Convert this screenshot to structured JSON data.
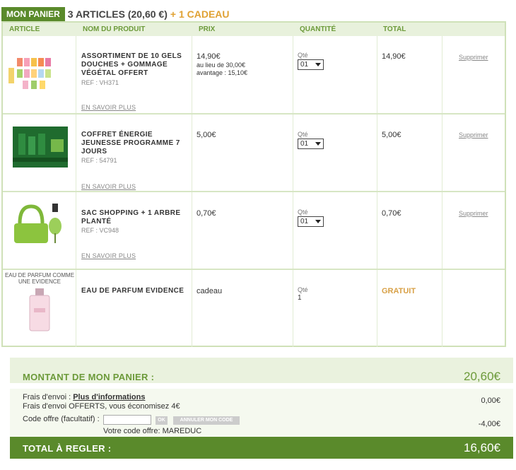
{
  "header": {
    "tab": "MON PANIER",
    "count": "3 ARTICLES (20,60 €)",
    "gift": "+ 1 CADEAU"
  },
  "columns": {
    "article": "ARTICLE",
    "name": "NOM DU PRODUIT",
    "price": "PRIX",
    "qty": "QUANTITÉ",
    "total": "TOTAL"
  },
  "items": [
    {
      "name": "ASSORTIMENT DE 10 GELS DOUCHES + GOMMAGE VÉGÉTAL OFFERT",
      "ref": "REF : VH371",
      "more": "EN SAVOIR PLUS",
      "price": "14,90€",
      "old": "au lieu de 30,00€",
      "saving": "avantage : 15,10€",
      "qty_label": "Qté",
      "qty": "01",
      "total": "14,90€",
      "delete": "Supprimer"
    },
    {
      "name": "COFFRET ÉNERGIE JEUNESSE PROGRAMME 7 JOURS",
      "ref": "REF : 54791",
      "more": "EN SAVOIR PLUS",
      "price": "5,00€",
      "qty_label": "Qté",
      "qty": "01",
      "total": "5,00€",
      "delete": "Supprimer"
    },
    {
      "name": "SAC SHOPPING + 1 ARBRE PLANTÉ",
      "ref": "REF : VC948",
      "more": "EN SAVOIR PLUS",
      "price": "0,70€",
      "qty_label": "Qté",
      "qty": "01",
      "total": "0,70€",
      "delete": "Supprimer"
    },
    {
      "name": "EAU DE PARFUM EVIDENCE",
      "image_caption": "EAU DE PARFUM COMME UNE EVIDENCE",
      "price": "cadeau",
      "qty_label": "Qté",
      "qty": "1",
      "total": "GRATUIT"
    }
  ],
  "summary": {
    "label": "MONTANT DE MON PANIER :",
    "amount": "20,60€",
    "shipping_label": "Frais d'envoi :",
    "shipping_link": "Plus d'informations",
    "shipping_free": "Frais d'envoi OFFERTS, vous économisez 4€",
    "shipping_amount": "0,00€",
    "code_label": "Code offre (facultatif) :",
    "ok": "OK",
    "cancel_code": "ANNULER MON CODE",
    "code_applied": "Votre code offre: MAREDUC",
    "discount": "-4,00€",
    "total_label": "TOTAL À REGLER :",
    "total": "16,60€"
  },
  "colors": {
    "green": "#5a8a2b",
    "light_green": "#eaf2de",
    "gold": "#e0a234"
  }
}
